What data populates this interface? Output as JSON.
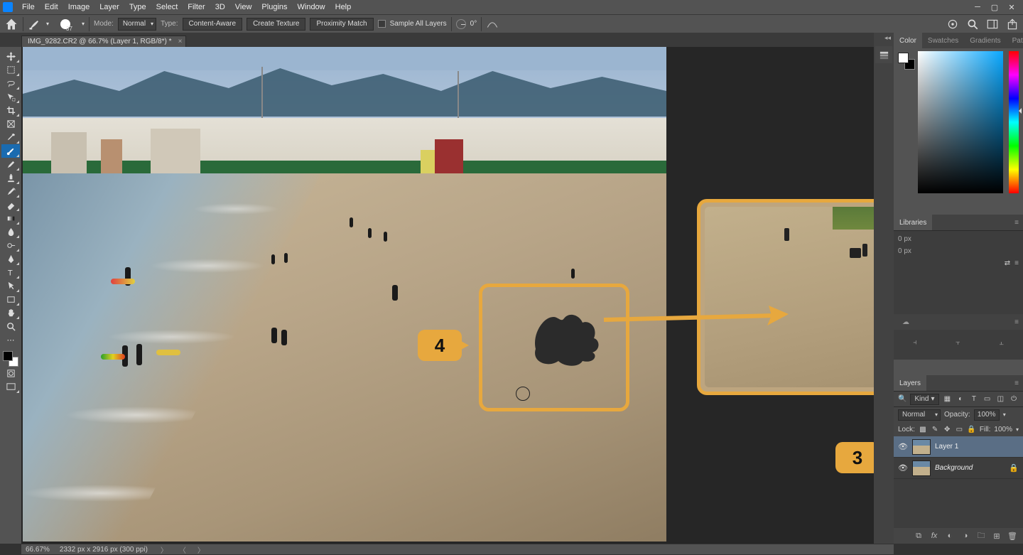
{
  "menu": {
    "items": [
      "File",
      "Edit",
      "Image",
      "Layer",
      "Type",
      "Select",
      "Filter",
      "3D",
      "View",
      "Plugins",
      "Window",
      "Help"
    ]
  },
  "options": {
    "brush_size": "37",
    "mode_label": "Mode:",
    "mode_value": "Normal",
    "type_label": "Type:",
    "type_buttons": [
      "Content-Aware",
      "Create Texture",
      "Proximity Match"
    ],
    "sample_all_label": "Sample All Layers",
    "angle_value": "0°"
  },
  "document": {
    "tab_title": "IMG_9282.CR2 @ 66.7% (Layer 1, RGB/8*) *"
  },
  "annotations": {
    "step3": "3",
    "step4": "4"
  },
  "panels": {
    "color_tabs": [
      "Color",
      "Swatches",
      "Gradients",
      "Patterns"
    ],
    "libraries_tab": "Libraries",
    "libraries": {
      "px1": "0 px",
      "px2": "0 px"
    },
    "layers_tab": "Layers",
    "layers": {
      "kind_label": "Kind",
      "blend_mode": "Normal",
      "opacity_label": "Opacity:",
      "opacity_value": "100%",
      "lock_label": "Lock:",
      "fill_label": "Fill:",
      "fill_value": "100%",
      "rows": [
        {
          "name": "Layer 1",
          "locked": false,
          "italic": false
        },
        {
          "name": "Background",
          "locked": true,
          "italic": true
        }
      ]
    }
  },
  "status": {
    "zoom": "66.67%",
    "doc_info": "2332 px x 2916 px (300 ppi)"
  },
  "colors": {
    "annotation": "#e7a83e",
    "selection": "#5a6e85"
  }
}
